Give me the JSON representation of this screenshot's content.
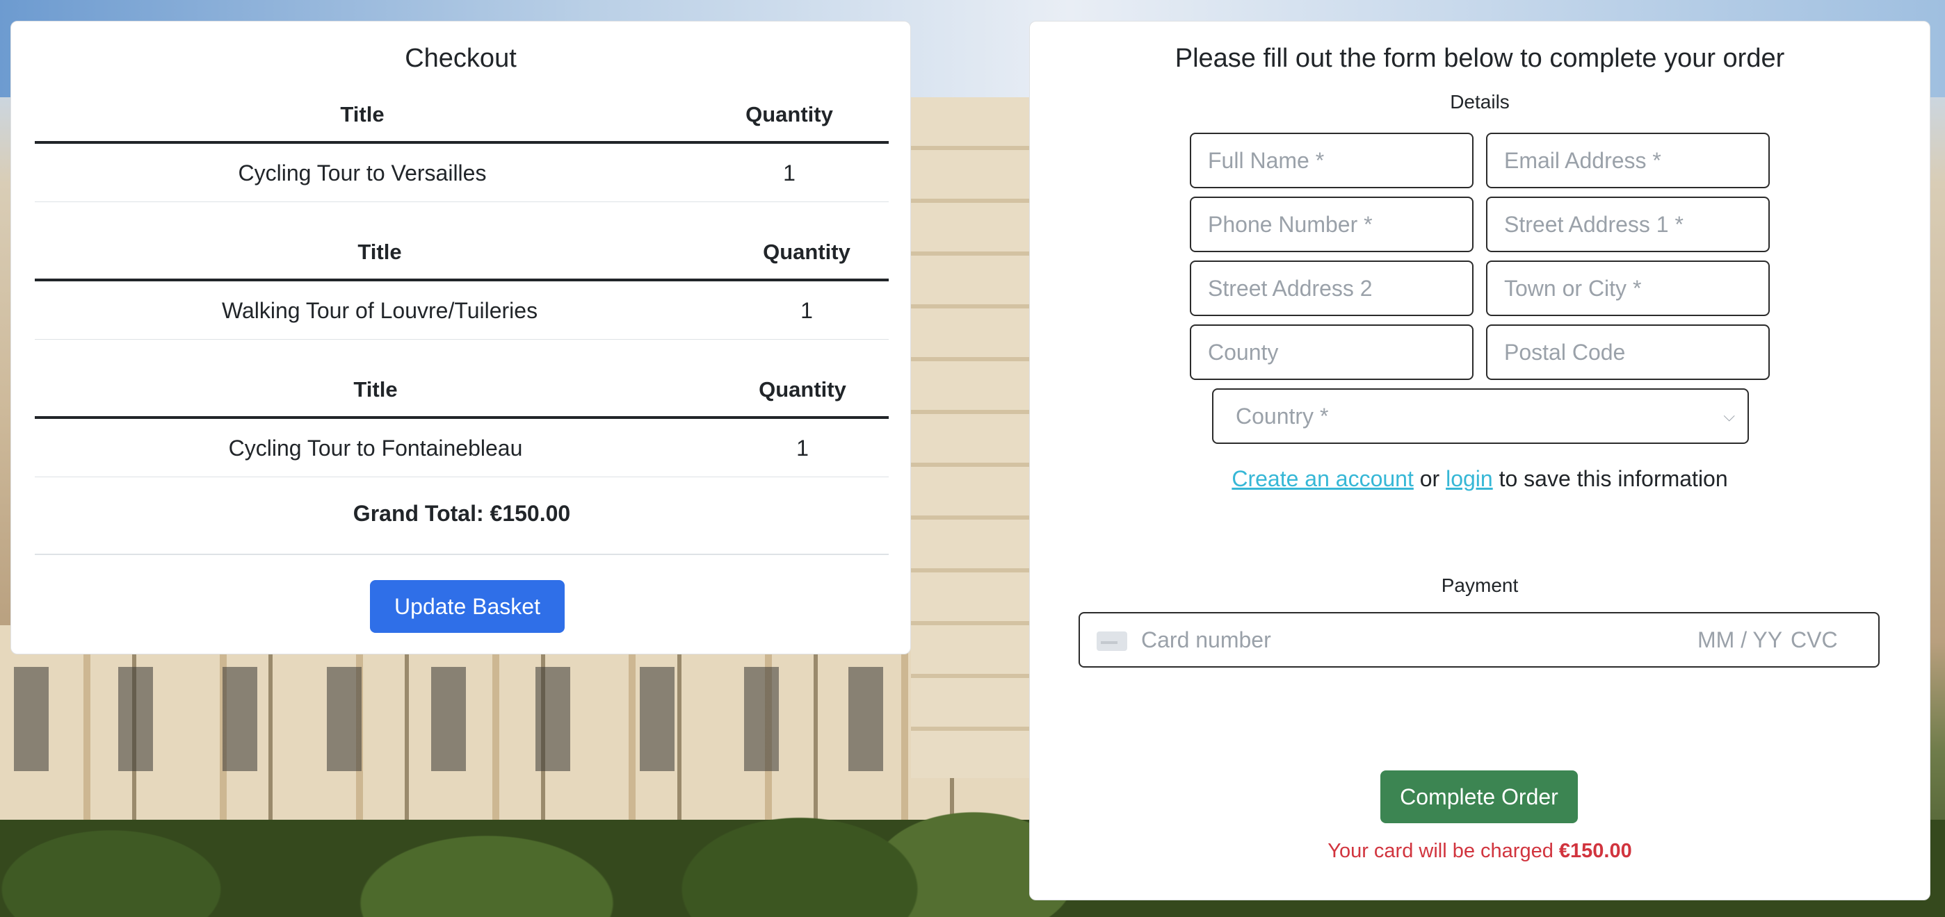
{
  "checkout": {
    "title": "Checkout",
    "items": [
      {
        "title_header": "Title",
        "qty_header": "Quantity",
        "title": "Cycling Tour to Versailles",
        "quantity": "1"
      },
      {
        "title_header": "Title",
        "qty_header": "Quantity",
        "title": "Walking Tour of Louvre/Tuileries",
        "quantity": "1"
      },
      {
        "title_header": "Title",
        "qty_header": "Quantity",
        "title": "Cycling Tour to Fontainebleau",
        "quantity": "1"
      }
    ],
    "grand_total": "Grand Total: €150.00",
    "update_label": "Update Basket"
  },
  "order": {
    "title": "Please fill out the form below to complete your order",
    "details_label": "Details",
    "fields": {
      "full_name": "Full Name *",
      "email": "Email Address *",
      "phone": "Phone Number *",
      "street1": "Street Address 1 *",
      "street2": "Street Address 2",
      "town": "Town or City *",
      "county": "County",
      "postal": "Postal Code"
    },
    "country_placeholder": "Country *",
    "account": {
      "create_link": "Create an account",
      "or_text": "or",
      "login_link": "login",
      "suffix": "to save this information"
    },
    "payment_label": "Payment",
    "card": {
      "number_placeholder": "Card number",
      "expiry_placeholder": "MM / YY",
      "cvc_placeholder": "CVC"
    },
    "complete_label": "Complete Order",
    "charge_text": "Your card will be charged",
    "charge_amount": "€150.00"
  },
  "colors": {
    "update_button": "#2f6fe8",
    "complete_button": "#3c8552",
    "link": "#36b7d6",
    "charge_text": "#d1343e"
  }
}
